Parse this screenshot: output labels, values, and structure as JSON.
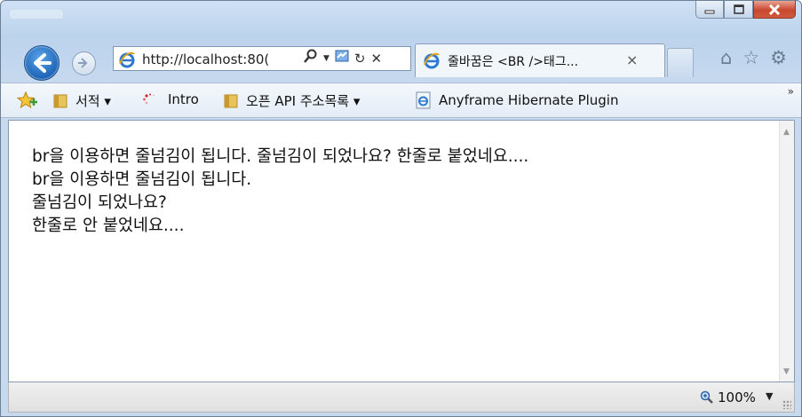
{
  "window": {
    "caption": {
      "minimize_icon": "minimize-icon",
      "maximize_icon": "maximize-icon",
      "close_icon": "close-icon"
    }
  },
  "nav": {
    "back_icon": "back-arrow-icon",
    "forward_icon": "forward-arrow-icon",
    "address": "http://localhost:80(",
    "address_tools": [
      "search-icon",
      "dropdown-icon",
      "compatibility-icon",
      "refresh-icon",
      "stop-icon"
    ]
  },
  "tab": {
    "label": "줄바꿈은 <BR />태그...",
    "close": "×"
  },
  "right_icons": [
    "home-icon",
    "favorites-star-icon",
    "settings-gear-icon"
  ],
  "favorites_bar": {
    "items": [
      {
        "label": "",
        "icon": "add-favorite-star-icon"
      },
      {
        "label": "서적 ▾",
        "icon": "folder-icon"
      },
      {
        "label": "Intro",
        "icon": "spinner-icon"
      },
      {
        "label": "오픈 API 주소목록 ▾",
        "icon": "folder-icon"
      },
      {
        "label": "Anyframe Hibernate Plugin",
        "icon": "ie-page-icon"
      }
    ],
    "more": "»"
  },
  "content": {
    "lines": [
      "br을 이용하면 줄넘김이 됩니다. 줄넘김이 되었나요? 한줄로 붙었네요....",
      "br을 이용하면 줄넘김이 됩니다.",
      "줄넘김이 되었나요?",
      "한줄로 안 붙었네요...."
    ]
  },
  "status": {
    "zoom": "100%",
    "zoom_dropdown": "▼"
  }
}
